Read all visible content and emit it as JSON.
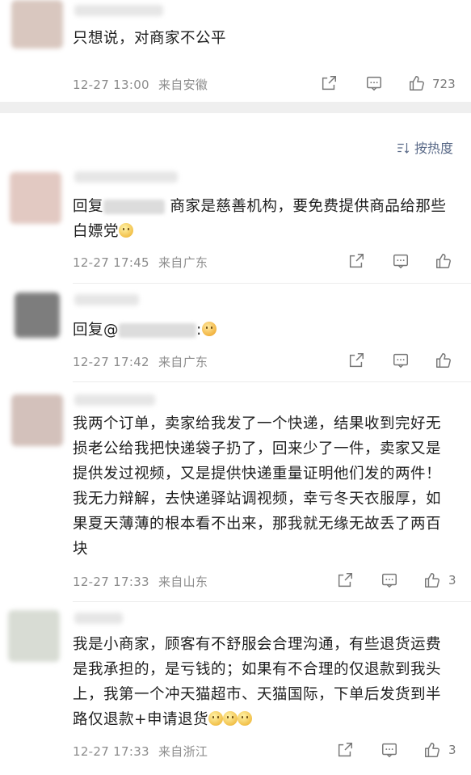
{
  "top_comment": {
    "text": "只想说，对商家不公平",
    "time": "12-27 13:00",
    "location": "来自安徽",
    "likes": "723"
  },
  "sort": {
    "label": "按热度",
    "icon": "sort-icon"
  },
  "replies": [
    {
      "reply_prefix": "回复",
      "text": "商家是慈善机构，要免费提供商品给那些白嫖党",
      "emoji": "slight-smile",
      "time": "12-27 17:45",
      "location": "来自广东",
      "likes": ""
    },
    {
      "reply_prefix": "回复@",
      "text": ":",
      "emoji": "crying-face",
      "time": "12-27 17:42",
      "location": "来自广东",
      "likes": ""
    },
    {
      "text": "我两个订单，卖家给我发了一个快递，结果收到完好无损老公给我把快递袋子扔了，回来少了一件，卖家又是提供发过视频，又是提供快递重量证明他们发的两件！我无力辩解，去快递驿站调视频，幸亏冬天衣服厚，如果夏天薄薄的根本看不出来，那我就无缘无故丢了两百块",
      "time": "12-27 17:33",
      "location": "来自山东",
      "likes": "3"
    },
    {
      "text": "我是小商家，顾客有不舒服会合理沟通，有些退货运费是我承担的，是亏钱的；如果有不合理的仅退款到我头上，我第一个冲天猫超市、天猫国际，下单后发货到半路仅退款+申请退货",
      "emoji": "slight-smile x3",
      "time": "12-27 17:33",
      "location": "来自浙江",
      "likes": "3"
    }
  ],
  "colors": {
    "text": "#1f1f1f",
    "meta": "#8c8c8c",
    "divider": "#ececec",
    "section_gap": "#efefef"
  }
}
